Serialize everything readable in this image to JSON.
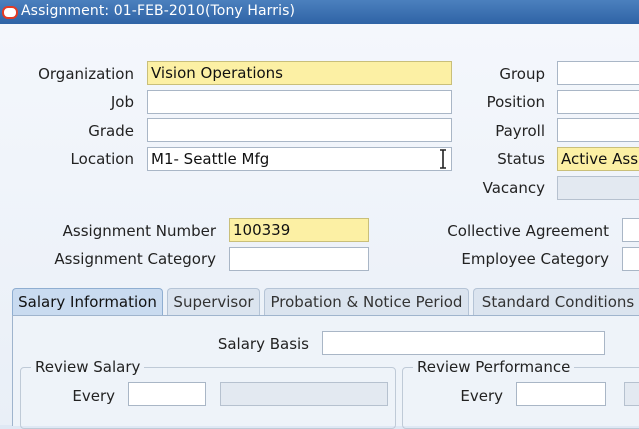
{
  "window": {
    "title": "Assignment: 01-FEB-2010(Tony Harris)"
  },
  "left_fields": {
    "organization": {
      "label": "Organization",
      "value": "Vision Operations"
    },
    "job": {
      "label": "Job",
      "value": ""
    },
    "grade": {
      "label": "Grade",
      "value": ""
    },
    "location": {
      "label": "Location",
      "value": "M1- Seattle Mfg"
    }
  },
  "right_fields": {
    "group": {
      "label": "Group",
      "value": ""
    },
    "position": {
      "label": "Position",
      "value": ""
    },
    "payroll": {
      "label": "Payroll",
      "value": ""
    },
    "status": {
      "label": "Status",
      "value": "Active Ass"
    },
    "vacancy": {
      "label": "Vacancy",
      "value": ""
    }
  },
  "assignment": {
    "number_label": "Assignment Number",
    "number_value": "100339",
    "category_label": "Assignment Category",
    "category_value": "",
    "collective_label": "Collective Agreement",
    "employee_category_label": "Employee Category"
  },
  "tabs": [
    {
      "label": "Salary Information",
      "active": true
    },
    {
      "label": "Supervisor"
    },
    {
      "label": "Probation & Notice Period"
    },
    {
      "label": "Standard Conditions"
    }
  ],
  "salary": {
    "basis_label": "Salary Basis",
    "basis_value": "",
    "review_salary_label": "Review Salary",
    "review_performance_label": "Review Performance",
    "every_label": "Every"
  },
  "colors": {
    "required": "#fcf0a4",
    "titlebar": "#2f63a6"
  }
}
